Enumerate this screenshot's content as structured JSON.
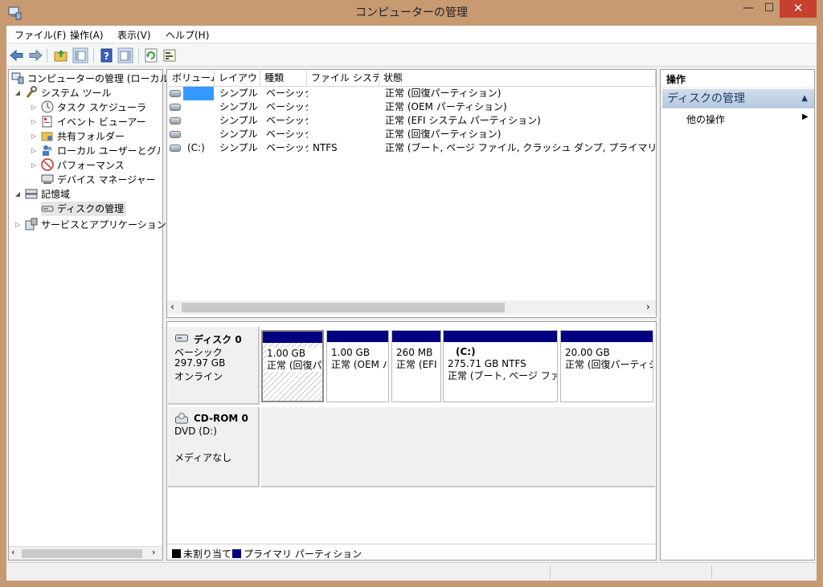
{
  "window": {
    "title": "コンピューターの管理",
    "minimize_glyph": "—",
    "maximize_glyph": "☐",
    "close_glyph": "✕"
  },
  "menu": [
    "ファイル(F)",
    "操作(A)",
    "表示(V)",
    "ヘルプ(H)"
  ],
  "toolbar": {
    "icons": [
      "back-arrow-icon",
      "forward-arrow-icon",
      "up-folder-icon",
      "show-hide-tree-icon",
      "help-icon",
      "show-hide-action-pane-icon",
      "refresh-icon",
      "properties-icon"
    ]
  },
  "tree": {
    "root": "コンピューターの管理 (ローカル)",
    "system_tools": "システム ツール",
    "task_scheduler": "タスク スケジューラ",
    "event_viewer": "イベント ビューアー",
    "shared_folders": "共有フォルダー",
    "local_users": "ローカル ユーザーとグループ",
    "performance": "パフォーマンス",
    "device_manager": "デバイス マネージャー",
    "storage": "記憶域",
    "disk_management": "ディスクの管理",
    "services_apps": "サービスとアプリケーション"
  },
  "volume_list": {
    "columns": [
      "ボリューム",
      "レイアウト",
      "種類",
      "ファイル システム",
      "状態"
    ],
    "rows": [
      {
        "volume": "",
        "layout": "シンプル",
        "type": "ベーシック",
        "fs": "",
        "status": "正常 (回復パーティション)"
      },
      {
        "volume": "",
        "layout": "シンプル",
        "type": "ベーシック",
        "fs": "",
        "status": "正常 (OEM パーティション)"
      },
      {
        "volume": "",
        "layout": "シンプル",
        "type": "ベーシック",
        "fs": "",
        "status": "正常 (EFI システム パーティション)"
      },
      {
        "volume": "",
        "layout": "シンプル",
        "type": "ベーシック",
        "fs": "",
        "status": "正常 (回復パーティション)"
      },
      {
        "volume": "(C:)",
        "layout": "シンプル",
        "type": "ベーシック",
        "fs": "NTFS",
        "status": "正常 (ブート, ページ ファイル, クラッシュ ダンプ, プライマリ パーティション)"
      }
    ]
  },
  "disks": {
    "disk0": {
      "name": "ディスク 0",
      "type": "ベーシック",
      "size": "297.97 GB",
      "state": "オンライン",
      "partitions": [
        {
          "size": "1.00 GB",
          "status": "正常 (回復パーティション)"
        },
        {
          "size": "1.00 GB",
          "status": "正常 (OEM パーティション)"
        },
        {
          "size": "260 MB",
          "status": "正常 (EFI システム パーティション)"
        },
        {
          "label": "(C:)",
          "size": "275.71 GB NTFS",
          "status": "正常 (ブート, ページ ファイル, クラッシュ ダンプ)"
        },
        {
          "size": "20.00 GB",
          "status": "正常 (回復パーティション)"
        }
      ]
    },
    "cdrom0": {
      "name": "CD-ROM 0",
      "type": "DVD (D:)",
      "state": "メディアなし"
    }
  },
  "legend": {
    "unallocated": "未割り当て",
    "primary": "プライマリ パーティション",
    "unallocated_color": "#000000",
    "primary_color": "#000080"
  },
  "actions": {
    "header": "操作",
    "section": "ディスクの管理",
    "more": "他の操作"
  }
}
